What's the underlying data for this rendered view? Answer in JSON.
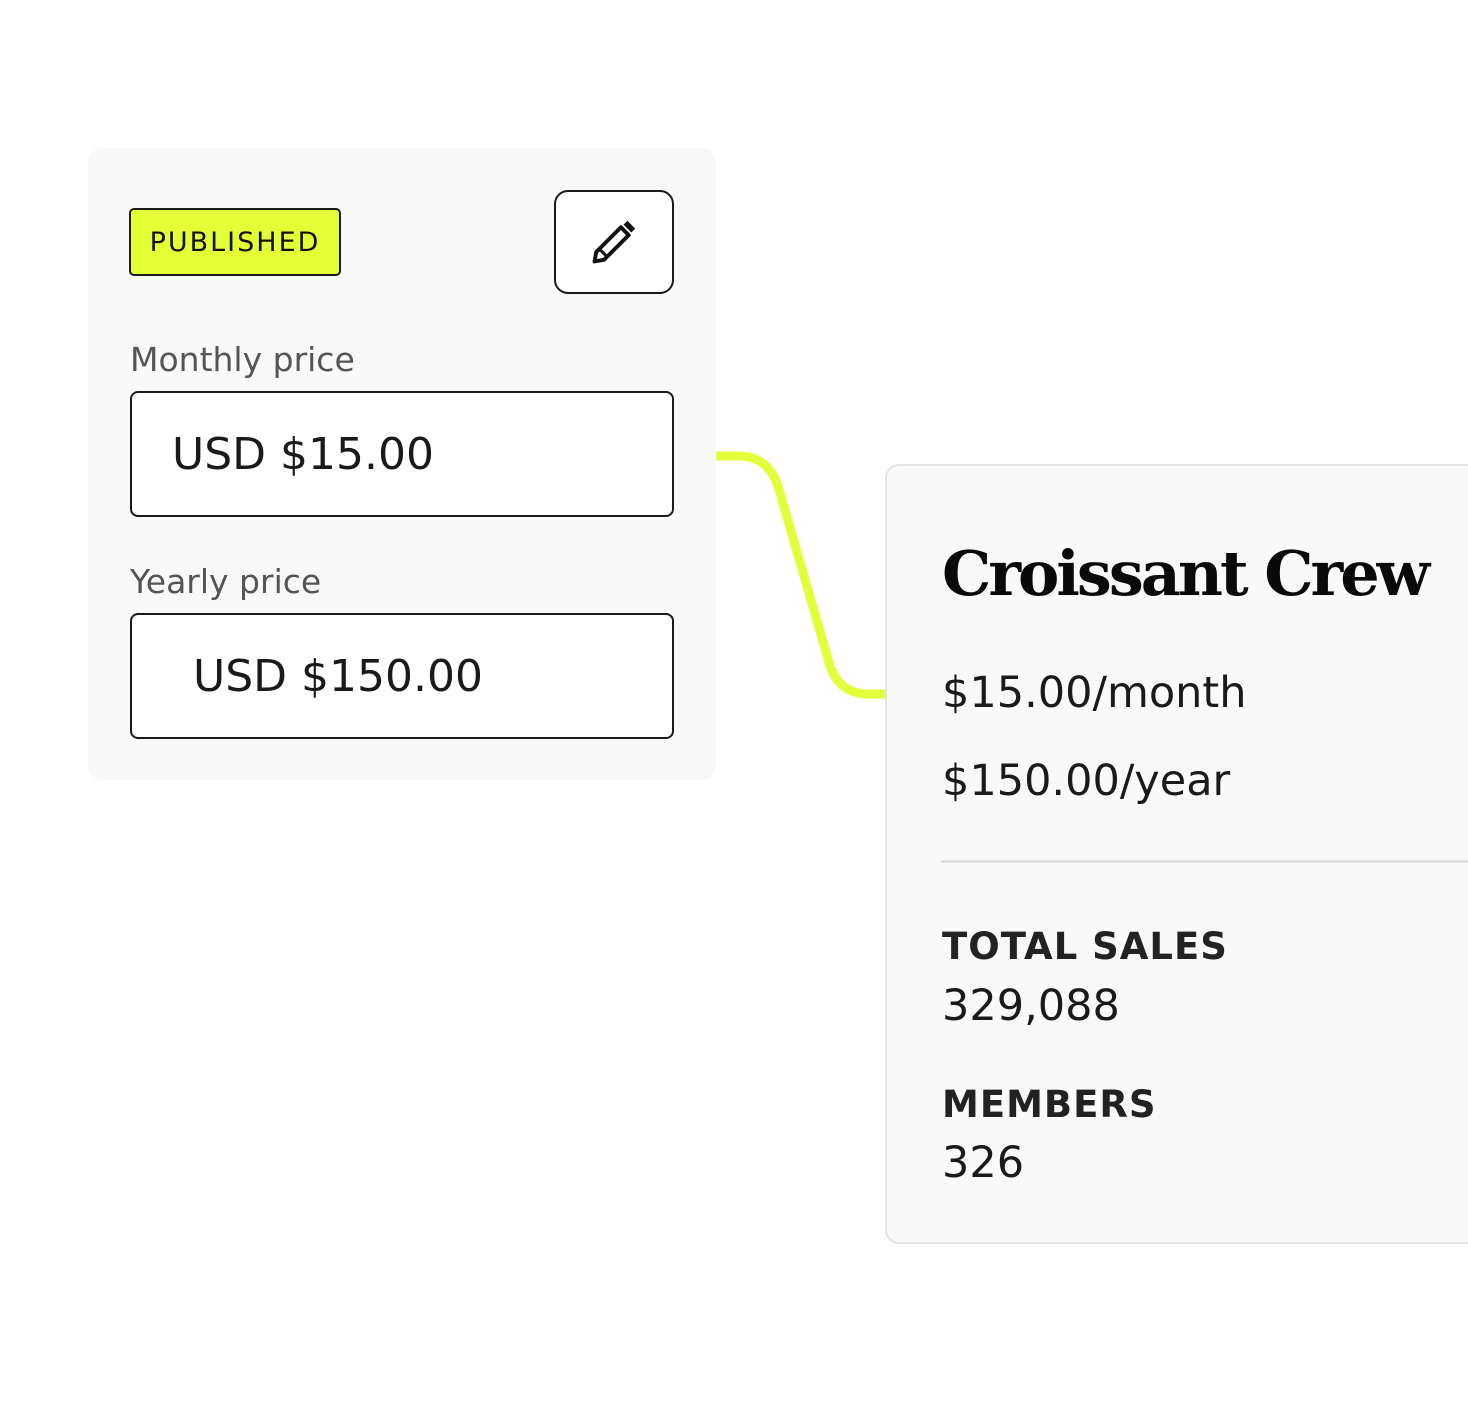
{
  "editor": {
    "status": "PUBLISHED",
    "edit_icon": "pencil-icon",
    "monthly": {
      "label": "Monthly price",
      "value": "USD $15.00"
    },
    "yearly": {
      "label": "Yearly price",
      "value": "USD $150.00"
    }
  },
  "summary": {
    "title": "Croissant Crew",
    "monthly_price": "$15.00/month",
    "yearly_price": "$150.00/year",
    "stats": [
      {
        "label": "TOTAL SALES",
        "value": "329,088"
      },
      {
        "label": "MEMBERS",
        "value": "326"
      }
    ]
  },
  "colors": {
    "accent": "#e5ff37",
    "connector": "#e3ff3b",
    "card_background": "#f9f9f9",
    "border": "#1a1a1a"
  }
}
